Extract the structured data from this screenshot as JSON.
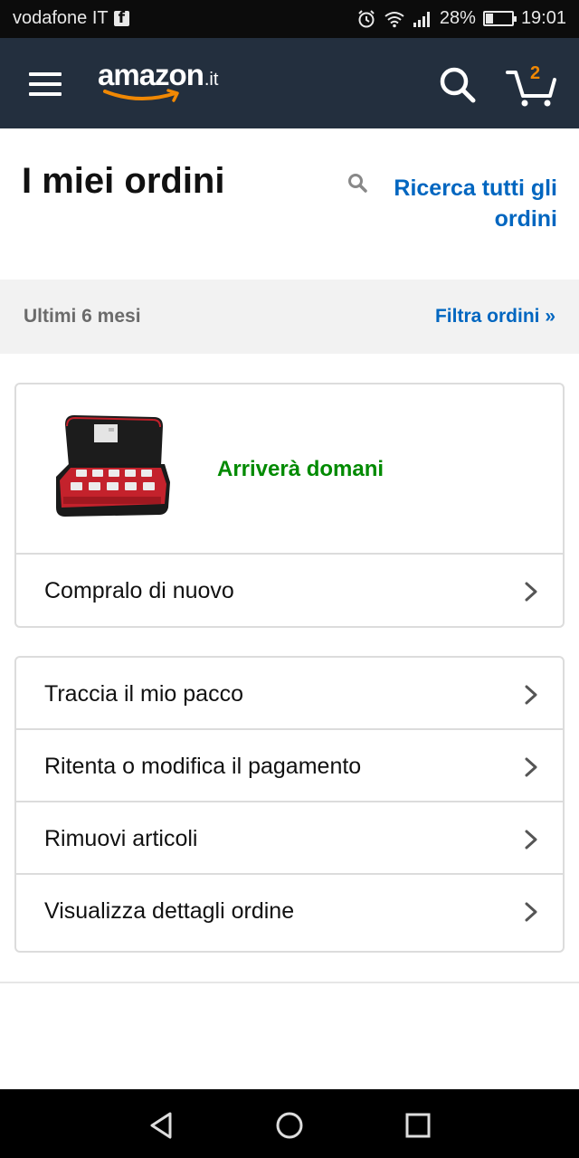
{
  "status_bar": {
    "carrier": "vodafone IT",
    "battery": "28%",
    "time": "19:01",
    "battery_level": 0.28
  },
  "header": {
    "logo_text": "amazon",
    "logo_tld": ".it",
    "cart_count": "2",
    "background": "#232f3e",
    "accent": "#f08804"
  },
  "page": {
    "title": "I miei ordini",
    "search_all_line1": "Ricerca tutti gli",
    "search_all_line2": "ordini"
  },
  "filter": {
    "period": "Ultimi 6 mesi",
    "link": "Filtra ordini »"
  },
  "order": {
    "delivery_status": "Arriverà domani",
    "buy_again": "Compralo di nuovo"
  },
  "actions": [
    {
      "label": "Traccia il mio pacco"
    },
    {
      "label": "Ritenta o modifica il pagamento"
    },
    {
      "label": "Rimuovi articoli"
    },
    {
      "label": "Visualizza dettagli ordine"
    }
  ],
  "colors": {
    "link": "#0066c0",
    "success": "#008a00"
  }
}
